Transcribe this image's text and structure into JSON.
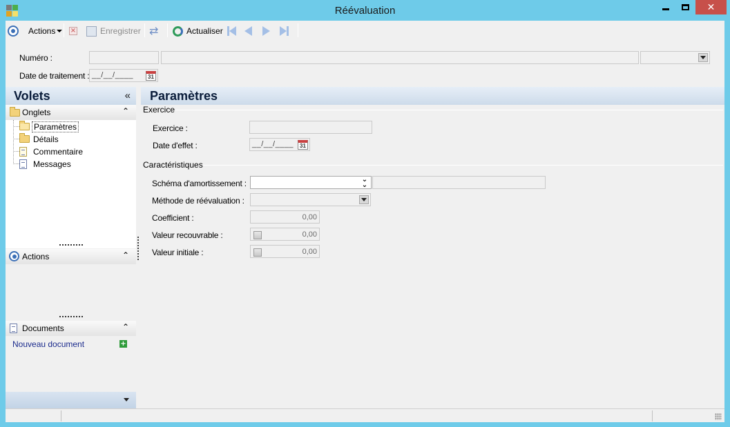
{
  "window": {
    "title": "Réévaluation",
    "close_glyph": "✕"
  },
  "toolbar": {
    "actions_label": "Actions",
    "save_label": "Enregistrer",
    "refresh_label": "Actualiser"
  },
  "header": {
    "numero_label": "Numéro :",
    "date_traitement_label": "Date de traitement :",
    "date_mask": "__/__/____",
    "calendar_day": "31"
  },
  "volets": {
    "title": "Volets",
    "collapse_glyph": "«",
    "chevron_up": "⌃",
    "onglets": {
      "title": "Onglets",
      "items": [
        "Paramètres",
        "Détails",
        "Commentaire",
        "Messages"
      ]
    },
    "actions": {
      "title": "Actions"
    },
    "documents": {
      "title": "Documents",
      "new_document": "Nouveau document",
      "plus_glyph": "+"
    }
  },
  "main": {
    "title": "Paramètres",
    "exercice_group": {
      "title": "Exercice",
      "exercice_label": "Exercice :",
      "date_effet_label": "Date d'effet :",
      "date_mask": "__/__/____",
      "calendar_day": "31"
    },
    "caracteristiques_group": {
      "title": "Caractéristiques",
      "schema_label": "Schéma d'amortissement :",
      "methode_label": "Méthode de réévaluation :",
      "coefficient_label": "Coefficient :",
      "coefficient_value": "0,00",
      "valeur_recouvrable_label": "Valeur recouvrable :",
      "valeur_recouvrable_value": "0,00",
      "valeur_initiale_label": "Valeur initiale :",
      "valeur_initiale_value": "0,00"
    }
  },
  "colors": {
    "titlebar": "#6ecbe9",
    "close_button": "#c7504a",
    "panel_header": "#cddbea",
    "link": "#1a2a8c"
  }
}
